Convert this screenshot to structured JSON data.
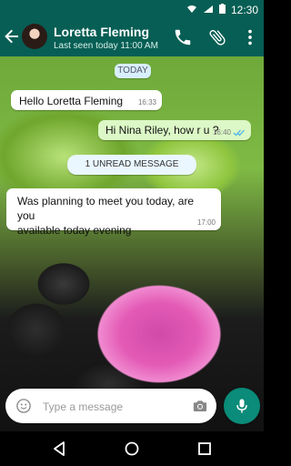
{
  "status_bar": {
    "time": "12:30"
  },
  "header": {
    "contact_name": "Loretta Fleming",
    "last_seen": "Last seen today 11:00 AM",
    "icons": [
      "back-arrow-icon",
      "avatar",
      "phone-icon",
      "attachment-icon",
      "more-vert-icon"
    ]
  },
  "chat": {
    "date_chip": "TODAY",
    "messages": [
      {
        "direction": "incoming",
        "text": "Hello Loretta Fleming",
        "time": "16:33"
      },
      {
        "direction": "outgoing",
        "text": "Hi Nina Riley, how r u ?",
        "time": "16:40",
        "status": "read"
      }
    ],
    "unread_label": "1 UNREAD MESSAGE",
    "unread_message": {
      "direction": "incoming",
      "text": "Was planning to meet you today, are you\navailable today evening",
      "time": "17:00"
    }
  },
  "composer": {
    "placeholder": "Type a message",
    "icons": [
      "emoji-icon",
      "camera-icon",
      "mic-icon"
    ]
  },
  "colors": {
    "appbar": "#075e54",
    "outgoing_bubble": "#dcf8c6",
    "mic_button": "#0b8b79"
  }
}
